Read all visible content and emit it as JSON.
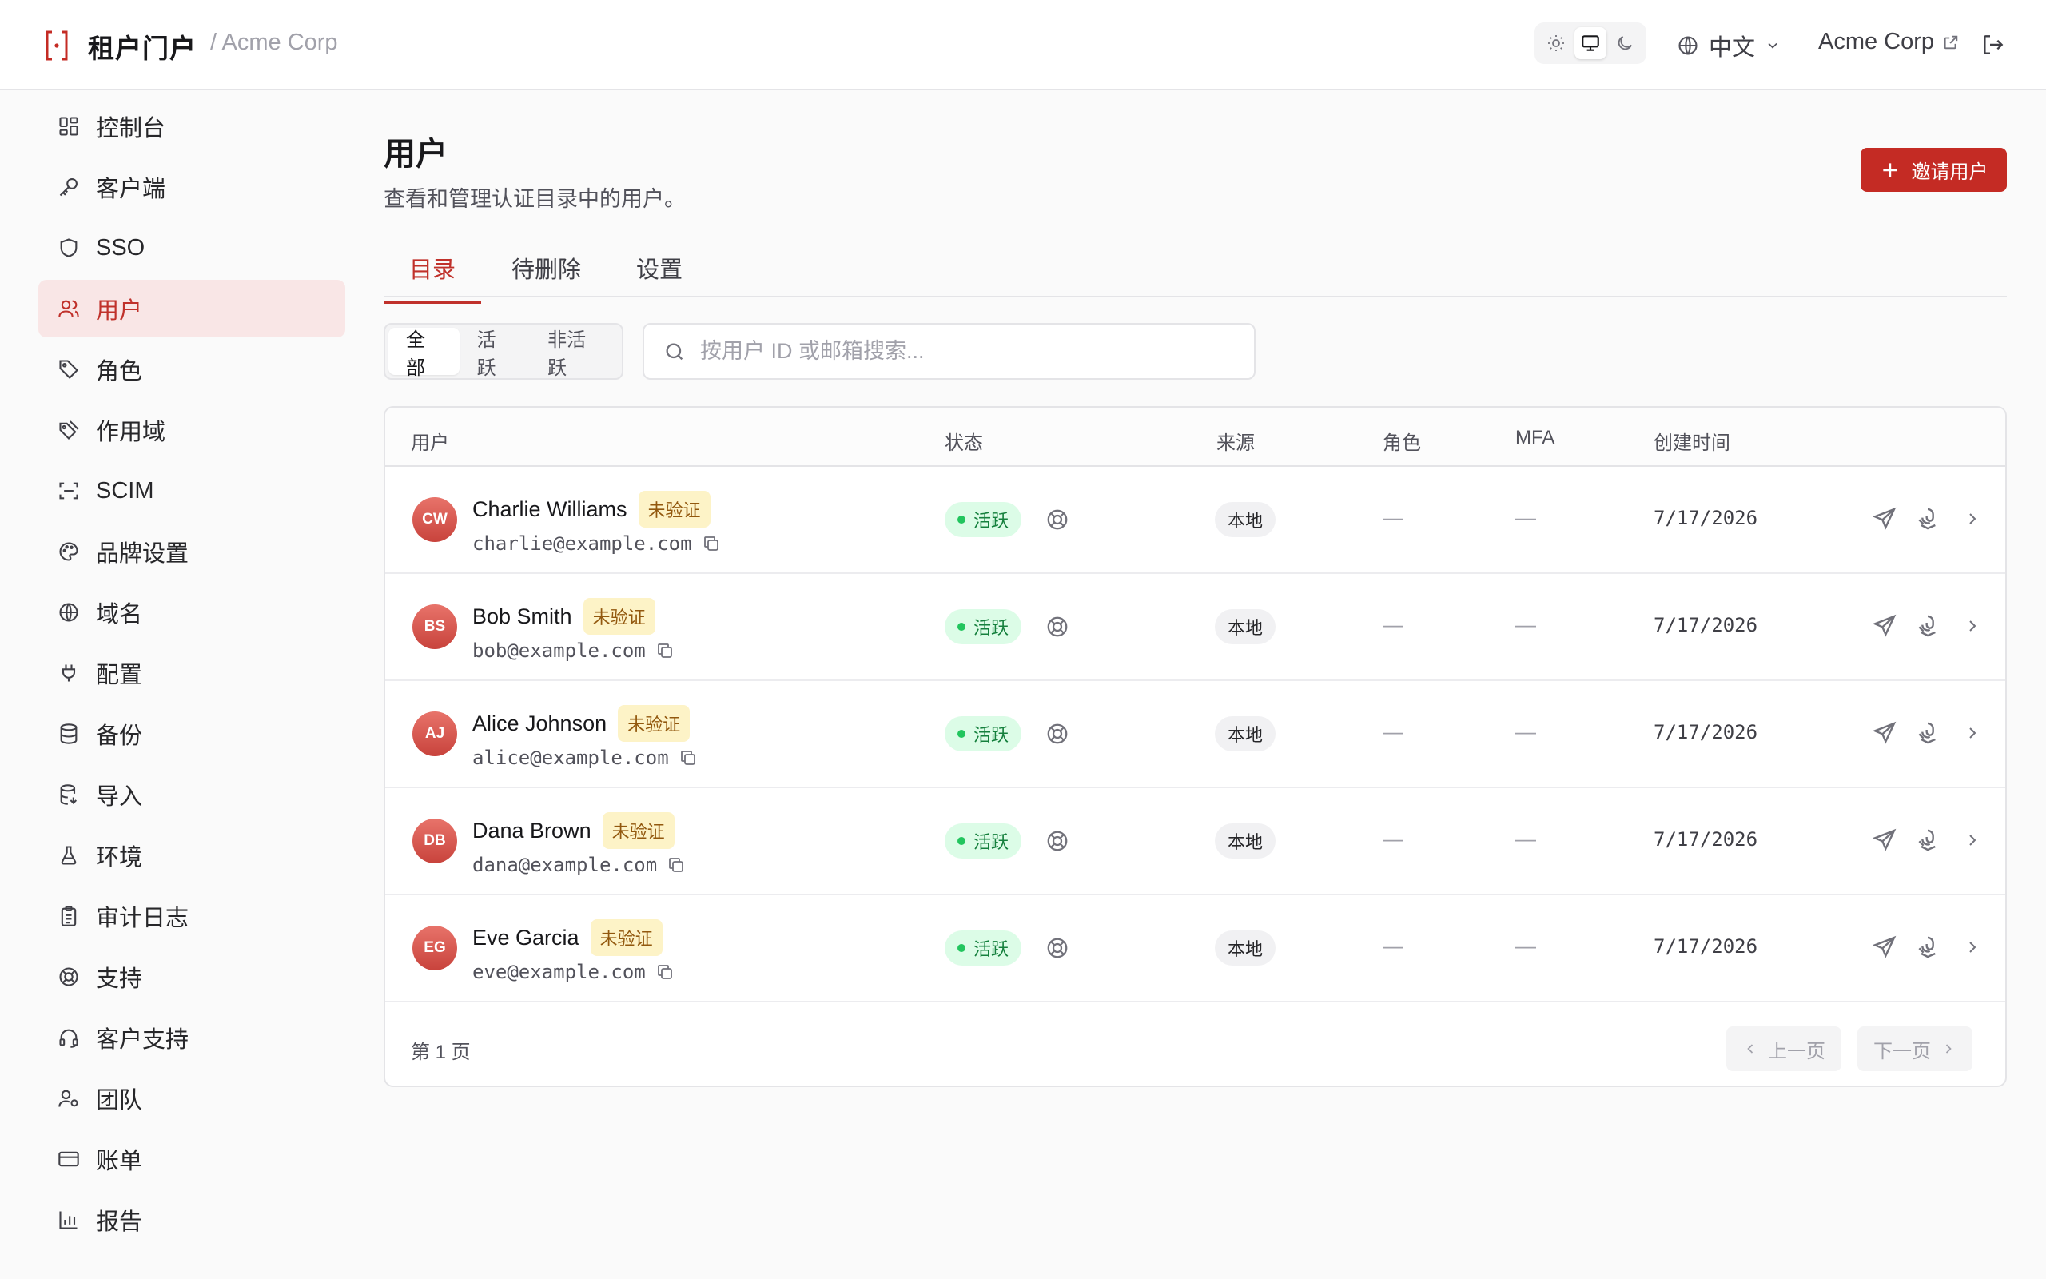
{
  "header": {
    "app_title": "租户门户",
    "org_breadcrumb": "/ Acme Corp",
    "theme_options": [
      "light",
      "system",
      "dark"
    ],
    "theme_selected": "system",
    "language": "中文",
    "tenant_name": "Acme Corp"
  },
  "sidebar": {
    "items": [
      {
        "label": "控制台",
        "icon": "dashboard-icon"
      },
      {
        "label": "客户端",
        "icon": "key-icon"
      },
      {
        "label": "SSO",
        "icon": "shield-icon"
      },
      {
        "label": "用户",
        "icon": "users-icon",
        "active": true
      },
      {
        "label": "角色",
        "icon": "tag-icon"
      },
      {
        "label": "作用域",
        "icon": "tags-icon"
      },
      {
        "label": "SCIM",
        "icon": "scan-icon"
      },
      {
        "label": "品牌设置",
        "icon": "palette-icon"
      },
      {
        "label": "域名",
        "icon": "globe-icon"
      },
      {
        "label": "配置",
        "icon": "plug-icon"
      },
      {
        "label": "备份",
        "icon": "database-icon"
      },
      {
        "label": "导入",
        "icon": "database-import-icon"
      },
      {
        "label": "环境",
        "icon": "flask-icon"
      },
      {
        "label": "审计日志",
        "icon": "clipboard-icon"
      },
      {
        "label": "支持",
        "icon": "lifebuoy-icon"
      },
      {
        "label": "客户支持",
        "icon": "headset-icon"
      },
      {
        "label": "团队",
        "icon": "user-cog-icon"
      },
      {
        "label": "账单",
        "icon": "credit-card-icon"
      },
      {
        "label": "报告",
        "icon": "bar-chart-icon"
      }
    ]
  },
  "main": {
    "title": "用户",
    "subtitle": "查看和管理认证目录中的用户。",
    "invite_button": "邀请用户",
    "tabs": [
      "目录",
      "待删除",
      "设置"
    ],
    "active_tab": "目录",
    "filters": [
      "全部",
      "活跃",
      "非活跃"
    ],
    "active_filter": "全部",
    "search_placeholder": "按用户 ID 或邮箱搜索...",
    "table": {
      "columns": [
        "用户",
        "状态",
        "来源",
        "角色",
        "MFA",
        "创建时间"
      ],
      "rows": [
        {
          "initials": "CW",
          "name": "Charlie Williams",
          "verify_badge": "未验证",
          "email": "charlie@example.com",
          "status": "活跃",
          "source": "本地",
          "roles": "—",
          "mfa": "—",
          "created": "7/17/2026"
        },
        {
          "initials": "BS",
          "name": "Bob Smith",
          "verify_badge": "未验证",
          "email": "bob@example.com",
          "status": "活跃",
          "source": "本地",
          "roles": "—",
          "mfa": "—",
          "created": "7/17/2026"
        },
        {
          "initials": "AJ",
          "name": "Alice Johnson",
          "verify_badge": "未验证",
          "email": "alice@example.com",
          "status": "活跃",
          "source": "本地",
          "roles": "—",
          "mfa": "—",
          "created": "7/17/2026"
        },
        {
          "initials": "DB",
          "name": "Dana Brown",
          "verify_badge": "未验证",
          "email": "dana@example.com",
          "status": "活跃",
          "source": "本地",
          "roles": "—",
          "mfa": "—",
          "created": "7/17/2026"
        },
        {
          "initials": "EG",
          "name": "Eve Garcia",
          "verify_badge": "未验证",
          "email": "eve@example.com",
          "status": "活跃",
          "source": "本地",
          "roles": "—",
          "mfa": "—",
          "created": "7/17/2026"
        }
      ]
    },
    "pagination": {
      "page_label": "第 1 页",
      "prev": "上一页",
      "next": "下一页"
    }
  },
  "colors": {
    "accent": "#c42b24",
    "active_nav_bg": "#f9e6e6",
    "status_active_bg": "#dcfce7",
    "status_active_text": "#15803d",
    "badge_unverified_bg": "#fdf3c7"
  }
}
